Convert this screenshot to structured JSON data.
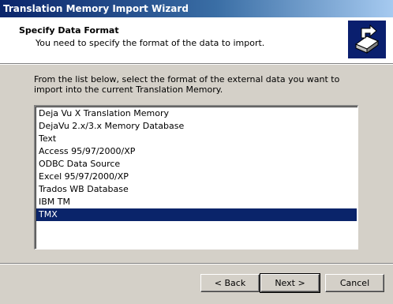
{
  "window": {
    "title": "Translation Memory Import Wizard"
  },
  "header": {
    "title": "Specify Data Format",
    "subtitle": "You need to specify the format of the data to import.",
    "icon": "import-wizard-icon"
  },
  "instructions": "From the list below, select the format of the external data you want to import into the current Translation Memory.",
  "formats": {
    "items": [
      "Deja Vu X Translation Memory",
      "DejaVu 2.x/3.x Memory Database",
      "Text",
      "Access 95/97/2000/XP",
      "ODBC Data Source",
      "Excel 95/97/2000/XP",
      "Trados WB Database",
      "IBM TM",
      "TMX"
    ],
    "selected": "TMX"
  },
  "buttons": {
    "back": "< Back",
    "next": "Next >",
    "cancel": "Cancel"
  },
  "colors": {
    "selection": "#0a246a",
    "titlebar_start": "#0a246a",
    "dialog_face": "#d4d0c8"
  }
}
